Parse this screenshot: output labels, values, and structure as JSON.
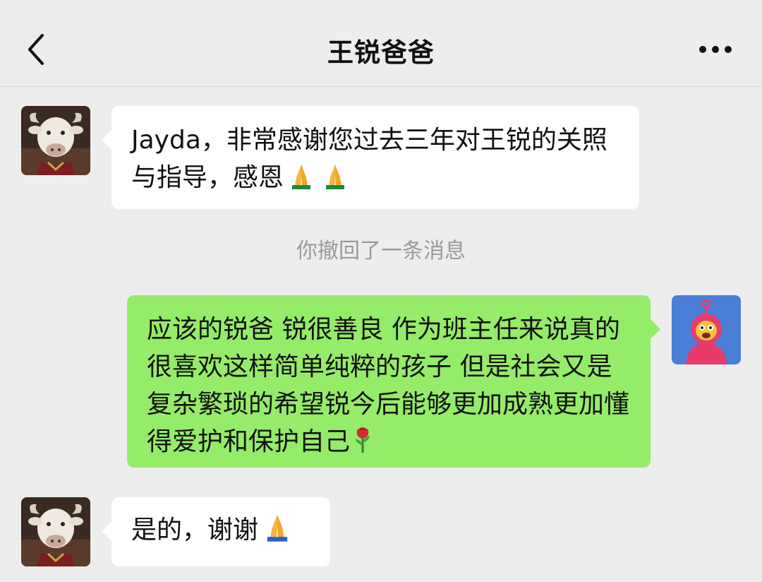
{
  "header": {
    "title": "王锐爸爸",
    "back_icon": "chevron-left-icon",
    "more_icon": "more-horizontal-icon"
  },
  "messages": [
    {
      "side": "in",
      "text": "Jayda，非常感谢您过去三年对王锐的关照与指导，感恩",
      "emojis": [
        "folded-hands",
        "folded-hands"
      ]
    },
    {
      "side": "system",
      "text": "你撤回了一条消息"
    },
    {
      "side": "out",
      "text": "应该的锐爸 锐很善良 作为班主任来说真的很喜欢这样简单纯粹的孩子 但是社会又是复杂繁琐的希望锐今后能够更加成熟更加懂得爱护和保护自己",
      "emojis": [
        "rose"
      ]
    },
    {
      "side": "in",
      "text": "是的，谢谢",
      "emojis": [
        "folded-hands"
      ]
    }
  ],
  "colors": {
    "background": "#ededed",
    "incoming_bubble": "#ffffff",
    "outgoing_bubble": "#95ec69",
    "system_text": "#9a9a9a"
  }
}
